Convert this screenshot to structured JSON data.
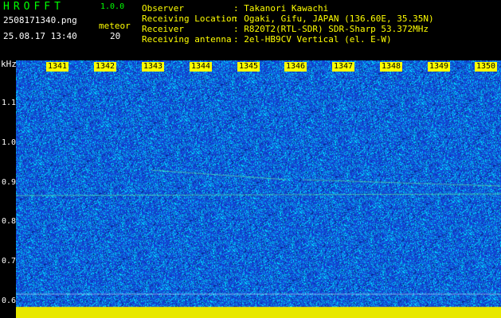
{
  "header": {
    "app_title": "HROFFT",
    "app_version": "1.0.0",
    "file_name": "2508171340.png",
    "datetime": "25.08.17 13:40",
    "meteor_label": "meteor",
    "meteor_count": "20"
  },
  "info": [
    {
      "key": "Observer",
      "value": ": Takanori Kawachi"
    },
    {
      "key": "Receiving Location",
      "value": ": Ogaki, Gifu, JAPAN (136.60E, 35.35N)"
    },
    {
      "key": "Receiver",
      "value": ": R820T2(RTL-SDR) SDR-Sharp 53.372MHz"
    },
    {
      "key": "Receiving antenna",
      "value": ": 2el-HB9CV Vertical (el. E-W)"
    }
  ],
  "axis": {
    "unit": "kHz",
    "y_ticks": [
      "1.1",
      "1.0",
      "0.9",
      "0.8",
      "0.7",
      "0.6"
    ],
    "x_ticks": [
      "1341",
      "1342",
      "1343",
      "1344",
      "1345",
      "1346",
      "1347",
      "1348",
      "1349",
      "1350"
    ]
  },
  "colors": {
    "background": "#000000",
    "noise_base": "#1e3ccf",
    "noise_high": "#00d8ff",
    "tick_label_bg": "#ffff00",
    "header_text": "#ffff00",
    "title_text": "#00ff00"
  }
}
